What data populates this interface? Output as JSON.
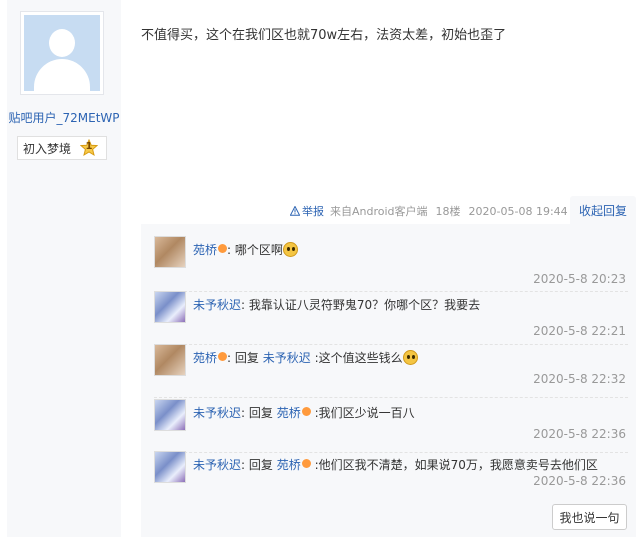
{
  "author": {
    "username": "贴吧用户_72MEtWP",
    "level_title": "初入梦境",
    "level_number": "1",
    "avatar_icon": "default-user-avatar"
  },
  "post": {
    "content": "不值得买，这个在我们区也就70w左右，法资太差，初始也歪了"
  },
  "tail": {
    "report_label": "举报",
    "source": "来自Android客户端",
    "floor": "18楼",
    "time": "2020-05-08 19:44",
    "collapse_label": "收起回复"
  },
  "replies": [
    {
      "user": "苑桥",
      "text": "哪个区啊",
      "time": "2020-5-8 20:23"
    },
    {
      "user": "未予秋迟",
      "text": "我靠认证八灵符野鬼70？你哪个区？我要去",
      "time": "2020-5-8 22:21"
    },
    {
      "user": "苑桥",
      "reply_word": "回复",
      "target": "未予秋迟",
      "text": ":这个值这些钱么",
      "time": "2020-5-8 22:32"
    },
    {
      "user": "未予秋迟",
      "reply_word": "回复",
      "target": "苑桥",
      "text": ":我们区少说一百八",
      "time": "2020-5-8 22:36"
    },
    {
      "user": "未予秋迟",
      "reply_word": "回复",
      "target": "苑桥",
      "text": ":他们区我不清楚，如果说70万，我愿意卖号去他们区",
      "time": "2020-5-8 22:36"
    }
  ],
  "reply_button": "我也说一句",
  "colors": {
    "link": "#2d64b3",
    "muted": "#999999",
    "panel": "#f7f8fa"
  }
}
